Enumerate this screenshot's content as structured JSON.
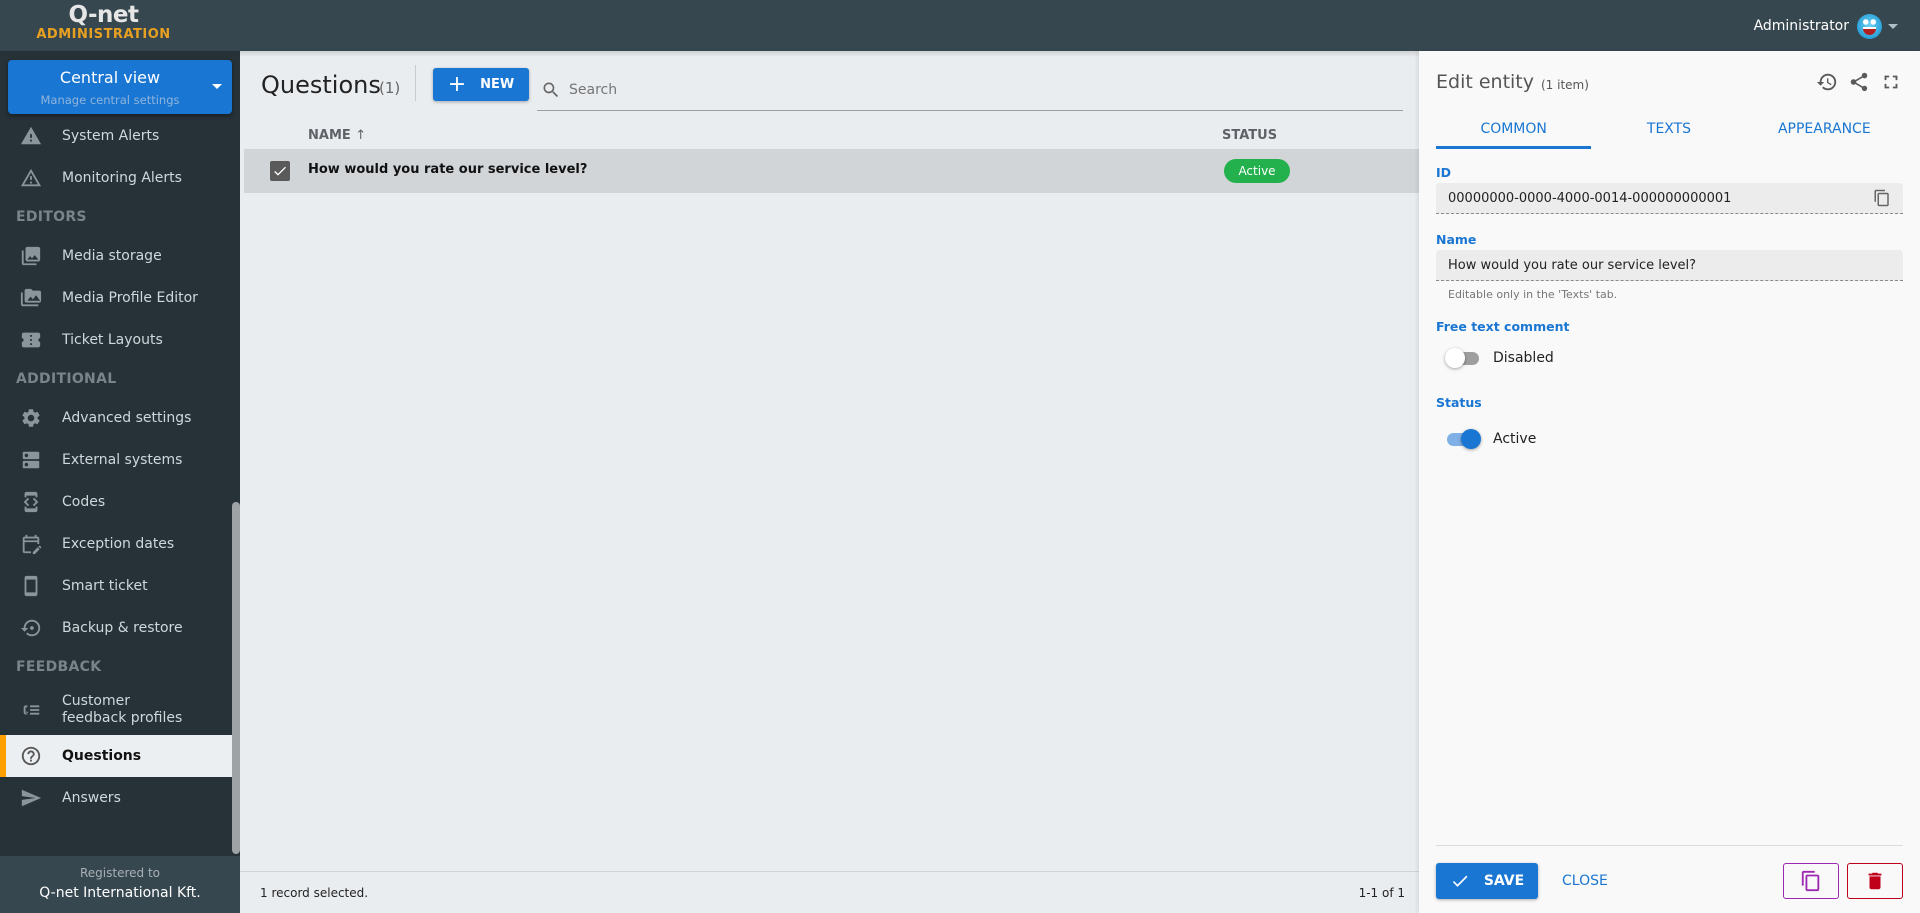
{
  "app": {
    "logo_mark": "Q-net",
    "logo_sub": "ADMINISTRATION"
  },
  "user": {
    "name": "Administrator",
    "avatar_icon": "smiley-avatar"
  },
  "central_view": {
    "title": "Central view",
    "subtitle": "Manage central settings"
  },
  "sidebar": {
    "items_top": [
      {
        "label": "System Alerts",
        "icon": "warning-filled-icon"
      },
      {
        "label": "Monitoring Alerts",
        "icon": "warning-outline-icon"
      }
    ],
    "sections": [
      {
        "title": "EDITORS",
        "items": [
          {
            "label": "Media storage",
            "icon": "image-library-icon"
          },
          {
            "label": "Media Profile Editor",
            "icon": "image-folder-icon"
          },
          {
            "label": "Ticket Layouts",
            "icon": "ticket-icon"
          }
        ]
      },
      {
        "title": "ADDITIONAL",
        "items": [
          {
            "label": "Advanced settings",
            "icon": "gear-sparkle-icon"
          },
          {
            "label": "External systems",
            "icon": "server-icon"
          },
          {
            "label": "Codes",
            "icon": "code-device-icon"
          },
          {
            "label": "Exception dates",
            "icon": "calendar-edit-icon"
          },
          {
            "label": "Smart ticket",
            "icon": "phone-icon"
          },
          {
            "label": "Backup & restore",
            "icon": "restore-icon"
          }
        ]
      },
      {
        "title": "FEEDBACK",
        "items": [
          {
            "label": "Customer feedback profiles",
            "icon": "feedback-list-icon"
          },
          {
            "label": "Questions",
            "icon": "help-circle-icon",
            "active": true
          },
          {
            "label": "Answers",
            "icon": "send-icon"
          }
        ]
      }
    ],
    "registered_label": "Registered to",
    "registered_name": "Q-net International Kft."
  },
  "list": {
    "title": "Questions",
    "count": "(1)",
    "new_label": "NEW",
    "search_placeholder": "Search",
    "columns": {
      "name": "NAME",
      "status": "STATUS"
    },
    "rows": [
      {
        "name": "How would you rate our service level?",
        "status": "Active",
        "selected": true
      }
    ],
    "selection_text": "1 record selected.",
    "pagination": "1-1 of 1"
  },
  "panel": {
    "title": "Edit entity",
    "subtitle": "(1 item)",
    "tabs": [
      "COMMON",
      "TEXTS",
      "APPEARANCE"
    ],
    "active_tab": "COMMON",
    "fields": {
      "id_label": "ID",
      "id_value": "00000000-0000-4000-0014-000000000001",
      "name_label": "Name",
      "name_value": "How would you rate our service level?",
      "name_hint": "Editable only in the 'Texts' tab.",
      "free_text_label": "Free text comment",
      "free_text_state": "Disabled",
      "free_text_on": false,
      "status_label": "Status",
      "status_state": "Active",
      "status_on": true
    },
    "save_label": "SAVE",
    "close_label": "CLOSE"
  },
  "colors": {
    "primary": "#1976d2",
    "accent": "#ffa000",
    "active_badge": "#22b14c",
    "danger": "#c0001a",
    "duplicate": "#9c27b0"
  }
}
